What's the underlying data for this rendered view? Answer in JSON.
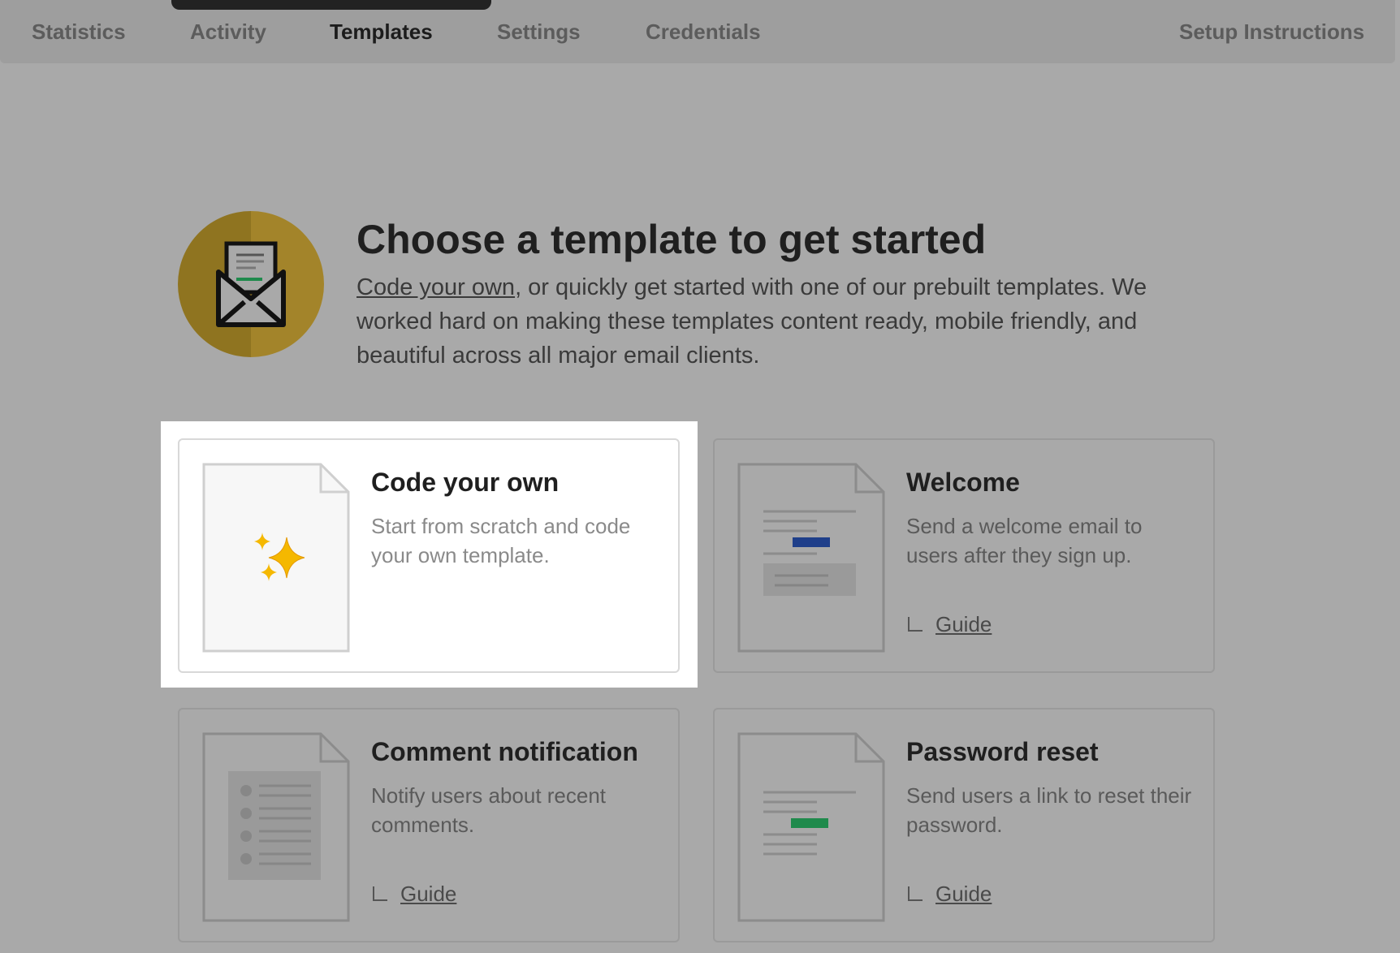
{
  "nav": {
    "tabs": [
      {
        "label": "Statistics"
      },
      {
        "label": "Activity"
      },
      {
        "label": "Templates"
      },
      {
        "label": "Settings"
      },
      {
        "label": "Credentials"
      }
    ],
    "active_tab": "Templates",
    "right_link": "Setup Instructions"
  },
  "hero": {
    "icon": "envelope-open-letter-icon",
    "title": "Choose a template to get started",
    "description_link": "Code your own",
    "description_rest": ", or quickly get started with one of our prebuilt templates. We worked hard on making these templates content ready, mobile friendly, and beautiful across all major email clients."
  },
  "templates": [
    {
      "title": "Code your own",
      "description": "Start from scratch and code your own template.",
      "guide": "",
      "icon": "sparkles-icon",
      "selected": true
    },
    {
      "title": "Welcome",
      "description": "Send a welcome email to users after they sign up.",
      "guide": "Guide",
      "icon": "welcome-email-preview-icon"
    },
    {
      "title": "Comment notification",
      "description": "Notify users about recent comments.",
      "guide": "Guide",
      "icon": "comment-list-preview-icon"
    },
    {
      "title": "Password reset",
      "description": "Send users a link to reset their password.",
      "guide": "Guide",
      "icon": "password-reset-preview-icon"
    }
  ],
  "colors": {
    "overlay_gray": "#a9a9a9",
    "badge_gold": "#a3842a",
    "welcome_button_blue": "#1f3f8a",
    "reset_button_green": "#1f8a4c",
    "sparkle_yellow": "#f5b800"
  }
}
